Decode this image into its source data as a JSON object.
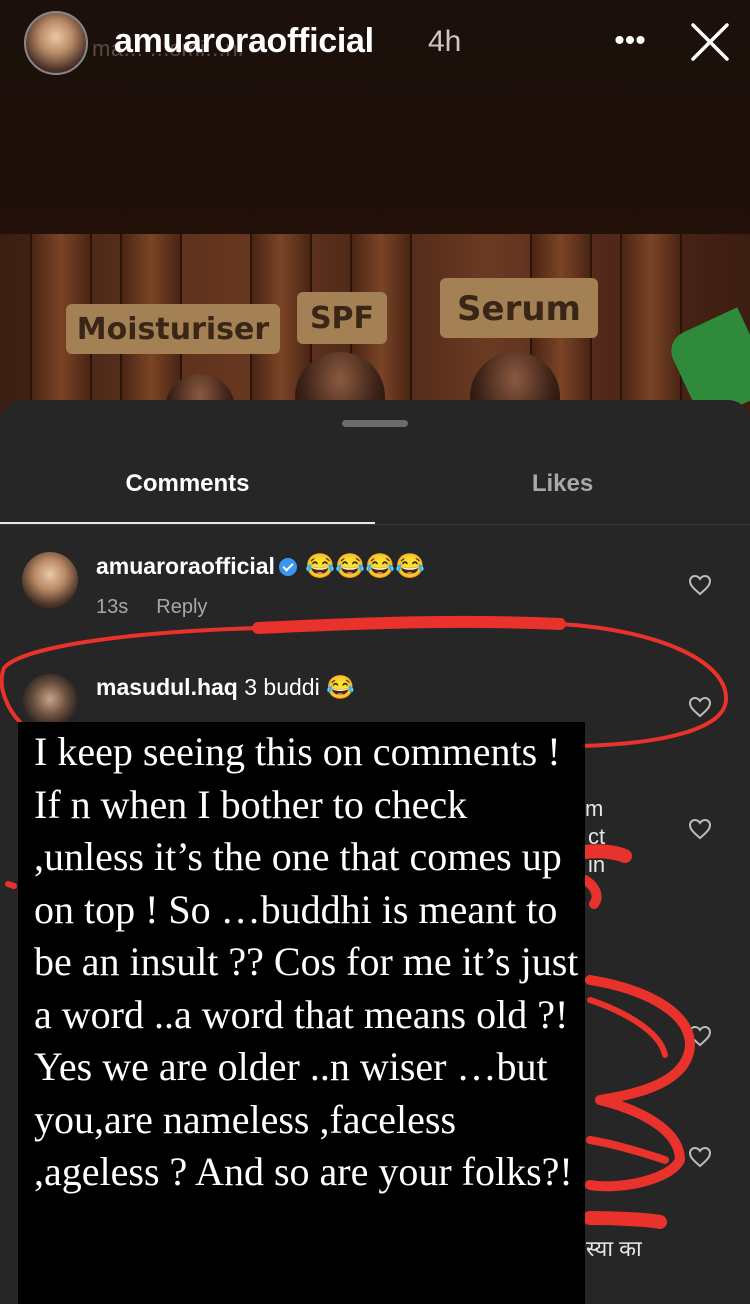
{
  "header": {
    "username": "amuaroraofficial",
    "time": "4h",
    "background_caption": "ma... ...smi...ni"
  },
  "story_labels": [
    "Moisturiser",
    "SPF",
    "Serum"
  ],
  "tabs": [
    {
      "label": "Comments",
      "active": true
    },
    {
      "label": "Likes",
      "active": false
    }
  ],
  "comments": [
    {
      "username": "amuaroraofficial",
      "verified": true,
      "text": "😂😂😂😂",
      "age": "13s",
      "reply_label": "Reply"
    },
    {
      "username": "masudul.haq",
      "verified": false,
      "text": "3 buddi 😂",
      "age": "",
      "reply_label": ""
    }
  ],
  "partial_text": [
    "m",
    "ct",
    "in",
    "स्या का"
  ],
  "overlay_note": "I keep seeing this on comments ! If n when I bother to check ,unless it’s the one that comes up on top ! So …buddhi is meant to be an insult ?? Cos for me it’s just a word ..a word that means old ?! Yes we are older ..n wiser …but you,are nameless ,faceless ,ageless ? And so are your folks?!",
  "colors": {
    "sheet_bg": "#262626",
    "scribble_red": "#e8322b",
    "verified_blue": "#3897f0",
    "muted_text": "#a8a8a8"
  }
}
